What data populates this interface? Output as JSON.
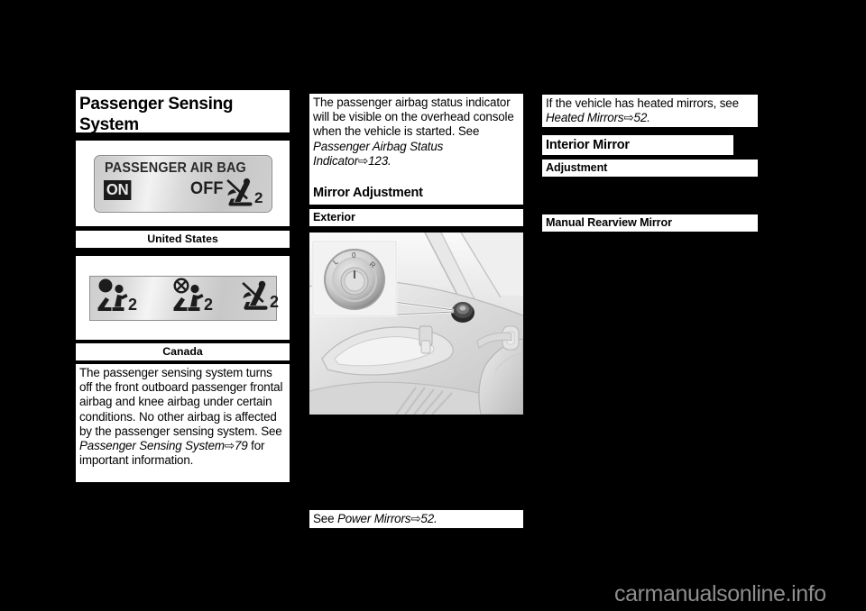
{
  "page": {
    "background_color": "#000000",
    "watermark": "carmanualsonline.info"
  },
  "left_column": {
    "section_title": "Passenger Sensing System",
    "us_display": {
      "label_top": "PASSENGER AIR BAG",
      "state_on": "ON",
      "state_off": "OFF",
      "icon_name": "passenger-airbag-off-symbol",
      "icon_number": "2"
    },
    "caption_us": "United States",
    "ca_display": {
      "icon1_name": "airbag-on-child-symbol",
      "icon1_number": "2",
      "icon2_name": "airbag-off-child-symbol",
      "icon2_number": "2",
      "icon3_name": "passenger-airbag-off-symbol",
      "icon3_number": "2"
    },
    "caption_ca": "Canada",
    "paragraph": {
      "part1": "The passenger sensing system turns off the front outboard passenger frontal airbag and knee airbag under certain conditions. No other airbag is affected by the passenger sensing system. See ",
      "ref_italic": "Passenger Sensing System",
      "ref_arrow": "⇨",
      "ref_page": "79",
      "part2": " for important information."
    }
  },
  "middle_column": {
    "paragraph": {
      "part1": "The passenger airbag status indicator will be visible on the overhead console when the vehicle is started. See ",
      "ref_italic": "Passenger Airbag Status Indicator",
      "ref_arrow": "⇨",
      "ref_page": "123",
      "part2": "."
    },
    "section_title": "Mirror Adjustment",
    "subheading": "Exterior",
    "photo_name": "exterior-mirror-control-photo",
    "photo_callout_labels": [
      "L",
      "0",
      "R"
    ],
    "see_line": {
      "prefix": "See ",
      "ref_italic": "Power Mirrors",
      "ref_arrow": "⇨",
      "ref_page": "52",
      "suffix": "."
    }
  },
  "right_column": {
    "paragraph": {
      "part1": "If the vehicle has heated mirrors, see ",
      "ref_italic": "Heated Mirrors",
      "ref_arrow": "⇨",
      "ref_page": "52",
      "part2": "."
    },
    "section_title": "Interior Mirror",
    "subheading": "Adjustment",
    "subheading2": "Manual Rearview Mirror"
  }
}
